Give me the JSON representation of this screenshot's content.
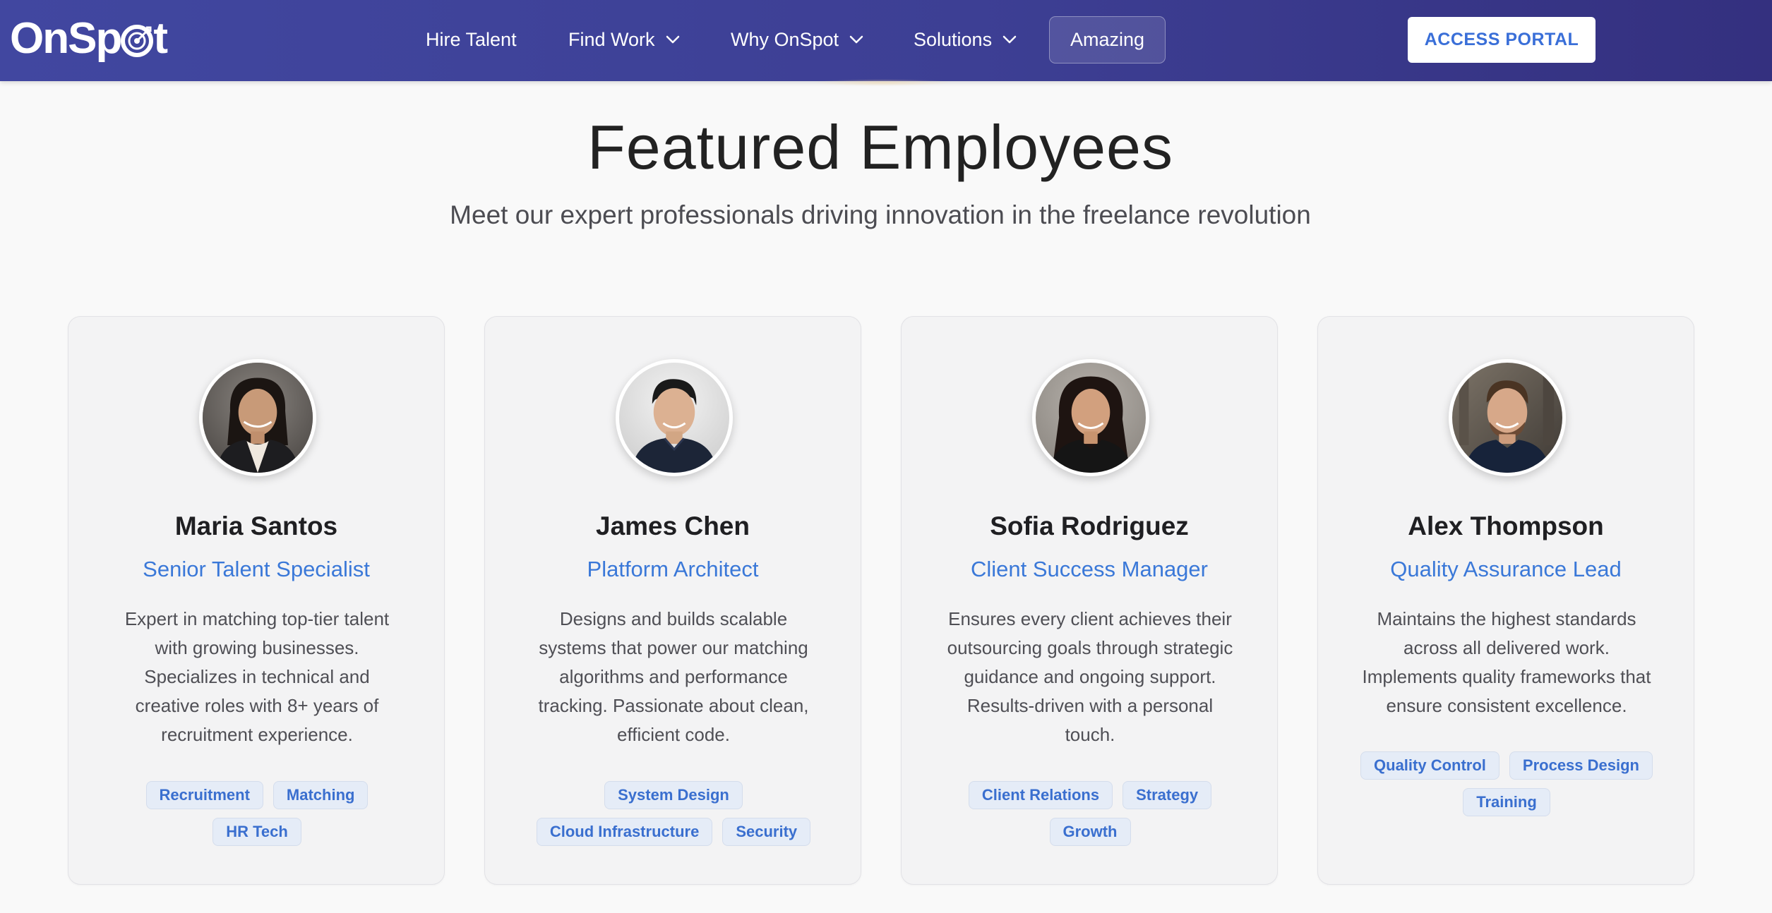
{
  "nav": {
    "logo_text_left": "OnSp",
    "logo_text_right": "t",
    "items": [
      {
        "label": "Hire Talent"
      },
      {
        "label": "Find Work"
      },
      {
        "label": "Why OnSpot"
      },
      {
        "label": "Solutions"
      }
    ],
    "amazing_label": "Amazing",
    "portal_label": "ACCESS PORTAL"
  },
  "hero": {
    "title": "Featured Employees",
    "subtitle": "Meet our expert professionals driving innovation in the freelance revolution"
  },
  "employees": [
    {
      "name": "Maria Santos",
      "role": "Senior Talent Specialist",
      "bio": "Expert in matching top-tier talent with growing businesses. Specializes in technical and creative roles with 8+ years of recruitment experience.",
      "tags": [
        "Recruitment",
        "Matching",
        "HR Tech"
      ]
    },
    {
      "name": "James Chen",
      "role": "Platform Architect",
      "bio": "Designs and builds scalable systems that power our matching algorithms and performance tracking. Passionate about clean, efficient code.",
      "tags": [
        "System Design",
        "Cloud Infrastructure",
        "Security"
      ]
    },
    {
      "name": "Sofia Rodriguez",
      "role": "Client Success Manager",
      "bio": "Ensures every client achieves their outsourcing goals through strategic guidance and ongoing support. Results-driven with a personal touch.",
      "tags": [
        "Client Relations",
        "Strategy",
        "Growth"
      ]
    },
    {
      "name": "Alex Thompson",
      "role": "Quality Assurance Lead",
      "bio": "Maintains the highest standards across all delivered work. Implements quality frameworks that ensure consistent excellence.",
      "tags": [
        "Quality Control",
        "Process Design",
        "Training"
      ]
    }
  ],
  "colors": {
    "nav_gradient_start": "#4147a0",
    "nav_gradient_end": "#34307f",
    "accent_blue": "#3a78d8",
    "tag_bg": "#e5ecf7",
    "page_bg": "#f9f9f9"
  },
  "icons": {
    "logo_o": "target-icon",
    "dropdown": "chevron-down-icon"
  }
}
